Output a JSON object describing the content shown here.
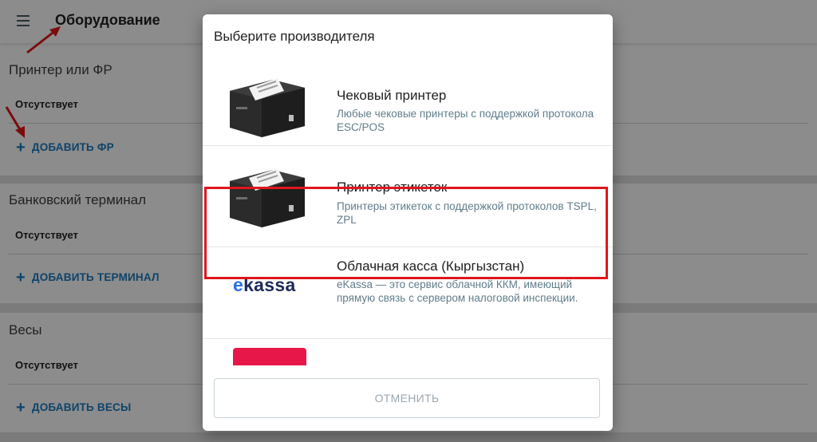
{
  "appbar": {
    "title": "Оборудование",
    "menu_icon": "hamburger-menu-icon"
  },
  "sections": {
    "fr": {
      "title": "Принтер или ФР",
      "status": "Отсутствует",
      "add_label": "ДОБАВИТЬ ФР"
    },
    "terminal": {
      "title": "Банковский терминал",
      "status": "Отсутствует",
      "add_label": "ДОБАВИТЬ ТЕРМИНАЛ"
    },
    "scales": {
      "title": "Весы",
      "status": "Отсутствует",
      "add_label": "ДОБАВИТЬ ВЕСЫ"
    }
  },
  "dialog": {
    "title": "Выберите производителя",
    "items": [
      {
        "title": "Чековый принтер",
        "desc": "Любые чековые принтеры с поддержкой протокола ESC/POS",
        "icon": "receipt-printer-image",
        "highlighted": false
      },
      {
        "title": "Принтер этикеток",
        "desc": "Принтеры этикеток с поддержкой протоколов TSPL, ZPL",
        "icon": "label-printer-image",
        "highlighted": true
      },
      {
        "title": "Облачная касса (Кыргызстан)",
        "desc": "eKassa — это сервис облачной ККМ, имеющий прямую связь с сервером налоговой инспекции.",
        "icon": "ekassa-logo",
        "logo_text_e": "e",
        "logo_text_rest": "kassa",
        "highlighted": false
      }
    ],
    "cancel_label": "ОТМЕНИТЬ"
  },
  "colors": {
    "accent": "#1a7bbf",
    "annotation": "#e0161b",
    "scrim": "rgba(0,0,0,0.45)",
    "ekassa_e": "#2b6fe0",
    "ekassa_text": "#1c2a5a",
    "partial_logo": "#e8174a"
  }
}
